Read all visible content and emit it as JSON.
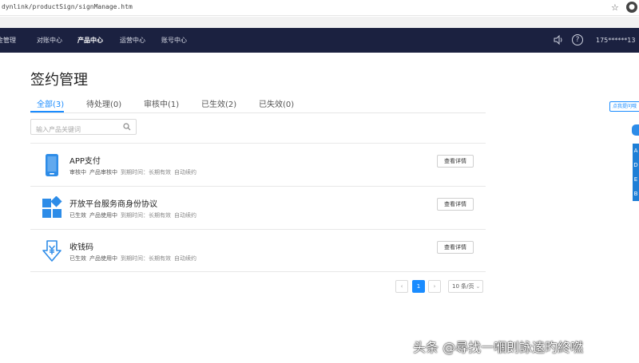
{
  "browser": {
    "url": "dynlink/productSign/signManage.htm",
    "star_glyph": "☆"
  },
  "nav": {
    "tabs": [
      {
        "label": "金管理"
      },
      {
        "label": "对账中心"
      },
      {
        "label": "产品中心"
      },
      {
        "label": "运营中心"
      },
      {
        "label": "账号中心"
      }
    ],
    "active_index": 2,
    "help_glyph": "?",
    "user": "175******13"
  },
  "page": {
    "title": "签约管理",
    "tabs": [
      {
        "label": "全部(3)"
      },
      {
        "label": "待处理(0)"
      },
      {
        "label": "审核中(1)"
      },
      {
        "label": "已生效(2)"
      },
      {
        "label": "已失效(0)"
      }
    ],
    "search_placeholder": "输入产品关键词"
  },
  "products": [
    {
      "name": "APP支付",
      "status": "审核中",
      "usage": "产品审核中",
      "expiry": "到期时间：长期有效",
      "renew": "自动续约",
      "button": "查看详情",
      "icon": "phone-icon"
    },
    {
      "name": "开放平台服务商身份协议",
      "status": "已生效",
      "usage": "产品使用中",
      "expiry": "到期时间：长期有效",
      "renew": "自动续约",
      "button": "查看详情",
      "icon": "grid-icon"
    },
    {
      "name": "收钱码",
      "status": "已生效",
      "usage": "产品使用中",
      "expiry": "到期时间：长期有效",
      "renew": "自动续约",
      "button": "查看详情",
      "icon": "yuan-download-icon"
    }
  ],
  "pagination": {
    "prev": "‹",
    "current": "1",
    "next": "›",
    "page_size": "10 条/页"
  },
  "float": {
    "tip": "点我提问哦",
    "sidebar_items": [
      "A",
      "D",
      "E",
      "B"
    ]
  },
  "watermark": "头条 @尋找一嗰剆詠逺旳終嘫",
  "colors": {
    "nav_bg": "#1b2140",
    "accent": "#1a8cff",
    "icon_blue": "#2d8ce8"
  }
}
